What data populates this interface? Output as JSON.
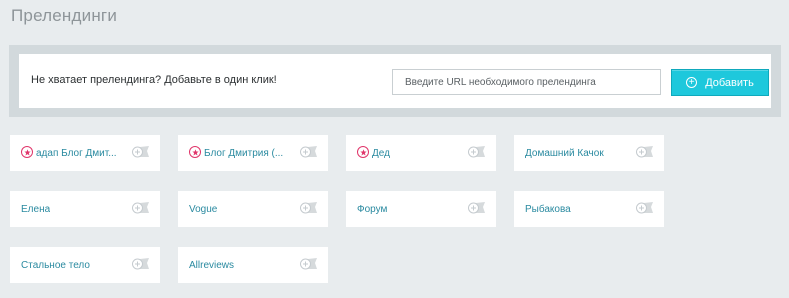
{
  "page": {
    "title": "Прелендинги"
  },
  "add_panel": {
    "label": "Не хватает прелендинга? Добавьте в один клик!",
    "input_placeholder": "Введите URL необходимого прелендинга",
    "input_value": "",
    "button_label": "Добавить",
    "button_icon": "plus-circle-icon"
  },
  "colors": {
    "accent": "#1ec8dc",
    "link": "#2a8aa0",
    "star": "#e0356a",
    "panel": "#d2d9dc",
    "background": "#e8ecee"
  },
  "prelandings": [
    {
      "label": "адап Блог Дмит...",
      "starred": true
    },
    {
      "label": "Блог Дмитрия (...",
      "starred": true
    },
    {
      "label": "Дед",
      "starred": true
    },
    {
      "label": "Домашний Качок",
      "starred": false
    },
    {
      "label": "Елена",
      "starred": false
    },
    {
      "label": "Vogue",
      "starred": false
    },
    {
      "label": "Форум",
      "starred": false
    },
    {
      "label": "Рыбакова",
      "starred": false
    },
    {
      "label": "Стальное тело",
      "starred": false
    },
    {
      "label": "Allreviews",
      "starred": false
    }
  ]
}
